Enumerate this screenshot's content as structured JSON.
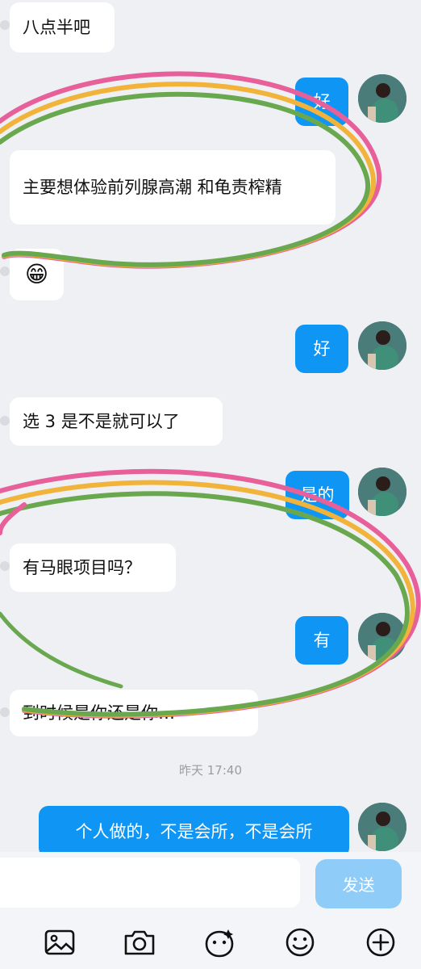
{
  "messages": {
    "m1": "八点半吧",
    "m2": "好",
    "m3": "主要想体验前列腺高潮  和龟责榨精",
    "m4_emoji": "😁",
    "m5": "好",
    "m6": "选 3 是不是就可以了",
    "m7": "是的",
    "m8": "有马眼项目吗？",
    "m9": "有",
    "m10": "到时候是你还是你…",
    "m11": "个人做的，不是会所，不是会所"
  },
  "timestamp": "昨天 17:40",
  "input": {
    "placeholder": ""
  },
  "send_label": "发送",
  "toolbar": [
    "image-icon",
    "camera-icon",
    "sticker-icon",
    "emoji-icon",
    "plus-icon"
  ],
  "colors": {
    "outgoing": "#0f95f3",
    "incoming": "#ffffff",
    "send_disabled": "#8fccf8",
    "background": "#eef0f4"
  }
}
